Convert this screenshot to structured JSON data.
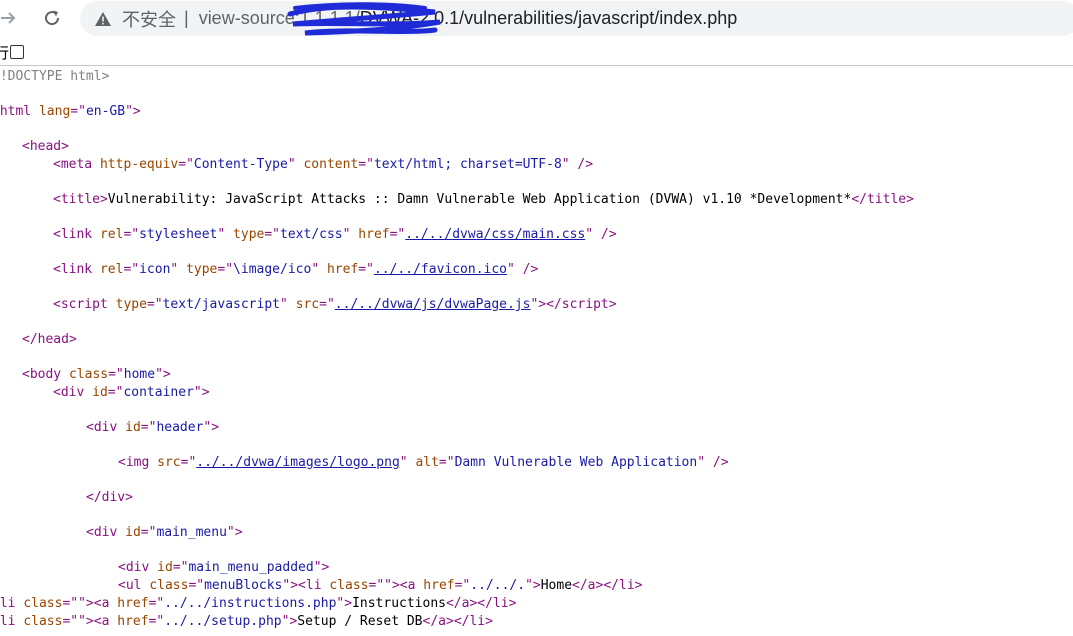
{
  "browser": {
    "security_label": "不安全",
    "separator": "|",
    "url_scheme": "view-source:",
    "url_obscured": "1.1.1.1/",
    "url_rest": "DVWA-2.0.1/vulnerabilities/javascript/index.php",
    "line_wrap_label": "行"
  },
  "source": {
    "doctype": "<!DOCTYPE html>",
    "html_open": {
      "tag": "html",
      "attr": "lang",
      "val": "en-GB"
    },
    "head_open": "head",
    "meta": {
      "a1": "http-equiv",
      "v1": "Content-Type",
      "a2": "content",
      "v2": "text/html; charset=UTF-8"
    },
    "title_text": "Vulnerability: JavaScript Attacks :: Damn Vulnerable Web Application (DVWA) v1.10 *Development*",
    "link_css": {
      "rel": "stylesheet",
      "type": "text/css",
      "href": "../../dvwa/css/main.css"
    },
    "link_icon": {
      "rel": "icon",
      "type": "\\image/ico",
      "href": "../../favicon.ico"
    },
    "script": {
      "type": "text/javascript",
      "src": "../../dvwa/js/dvwaPage.js"
    },
    "head_close": "head",
    "body": {
      "class": "home"
    },
    "container": {
      "id": "container"
    },
    "header": {
      "id": "header"
    },
    "img": {
      "src": "../../dvwa/images/logo.png",
      "alt": "Damn Vulnerable Web Application"
    },
    "main_menu": {
      "id": "main_menu"
    },
    "main_menu_padded": {
      "id": "main_menu_padded"
    },
    "menu_ul": {
      "class": "menuBlocks",
      "li_class": "",
      "href": "../../.",
      "text": "Home"
    },
    "menu_instructions": {
      "href": "../../instructions.php",
      "text": "Instructions"
    },
    "menu_setup": {
      "href": "../../setup.php",
      "text": "Setup / Reset DB"
    }
  },
  "colors": {
    "tag": "#881280",
    "attr_name": "#994500",
    "attr_value": "#1a1aa6",
    "comment": "#808080"
  }
}
